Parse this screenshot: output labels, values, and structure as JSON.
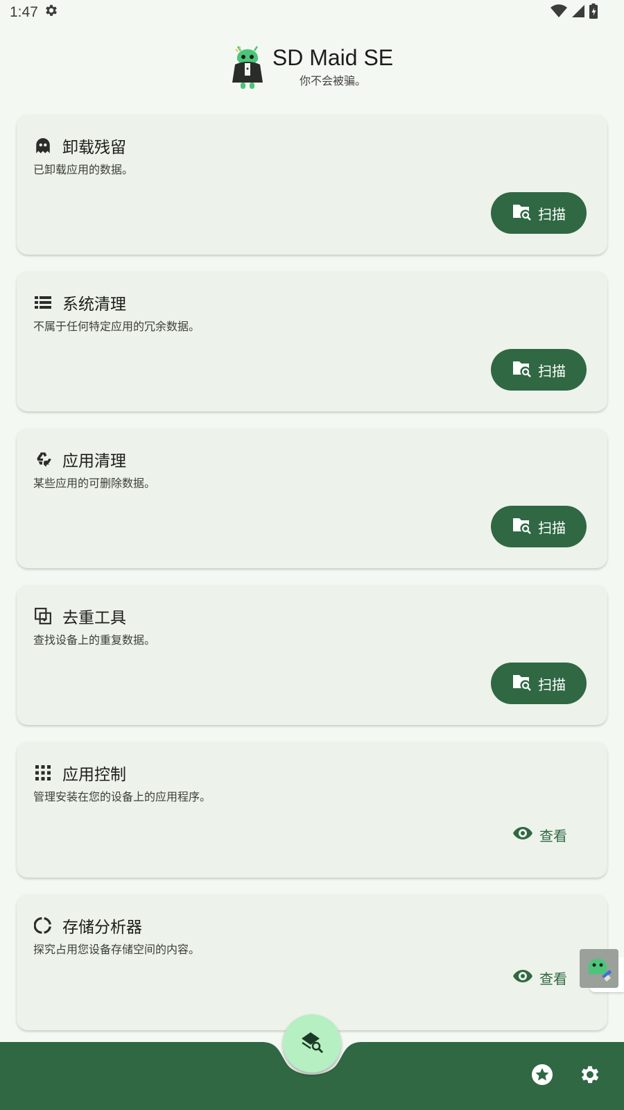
{
  "status_bar": {
    "time": "1:47"
  },
  "header": {
    "title": "SD Maid SE",
    "subtitle": "你不会被骗。"
  },
  "cards": [
    {
      "title": "卸载残留",
      "description": "已卸载应用的数据。",
      "action": "扫描",
      "icon": "ghost-icon"
    },
    {
      "title": "系统清理",
      "description": "不属于任何特定应用的冗余数据。",
      "action": "扫描",
      "icon": "list-icon"
    },
    {
      "title": "应用清理",
      "description": "某些应用的可删除数据。",
      "action": "扫描",
      "icon": "recycle-icon"
    },
    {
      "title": "去重工具",
      "description": "查找设备上的重复数据。",
      "action": "扫描",
      "icon": "duplicate-icon"
    },
    {
      "title": "应用控制",
      "description": "管理安装在您的设备上的应用程序。",
      "action": "查看",
      "icon": "grid-icon"
    },
    {
      "title": "存储分析器",
      "description": "探究占用您设备存储空间的内容。",
      "action": "查看",
      "icon": "donut-icon"
    }
  ],
  "colors": {
    "primary": "#2f6843",
    "card_bg": "#edf2ea",
    "page_bg": "#f4f8f2",
    "fab": "#b6efc2"
  }
}
